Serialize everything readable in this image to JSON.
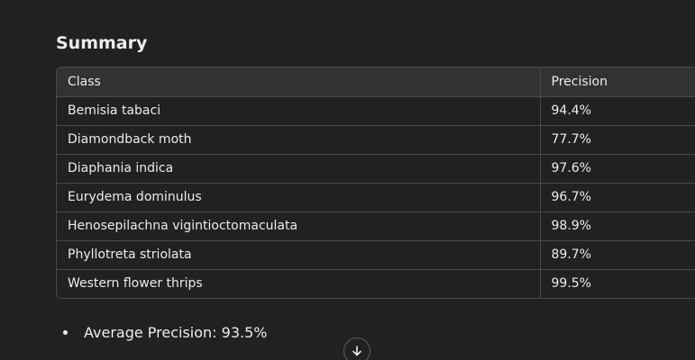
{
  "summary": {
    "heading": "Summary",
    "table": {
      "headers": [
        "Class",
        "Precision"
      ],
      "rows": [
        {
          "class": "Bemisia tabaci",
          "precision": "94.4%"
        },
        {
          "class": "Diamondback moth",
          "precision": "77.7%"
        },
        {
          "class": "Diaphania indica",
          "precision": "97.6%"
        },
        {
          "class": "Eurydema dominulus",
          "precision": "96.7%"
        },
        {
          "class": "Henosepilachna vigintioctomaculata",
          "precision": "98.9%"
        },
        {
          "class": "Phyllotreta striolata",
          "precision": "89.7%"
        },
        {
          "class": "Western flower thrips",
          "precision": "99.5%"
        }
      ]
    },
    "bullets": [
      "Average Precision: 93.5%"
    ]
  },
  "scroll_button": {
    "icon": "arrow-down-icon"
  },
  "colors": {
    "background": "#212121",
    "header_row": "#323232",
    "border": "#4a4a4a",
    "text": "#ececec"
  }
}
